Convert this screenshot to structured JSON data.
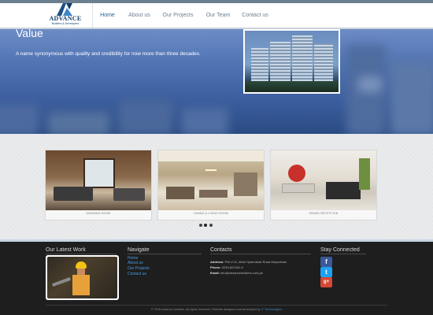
{
  "header": {
    "logo": {
      "word": "ADVANCE",
      "tagline": "Builders & Developers"
    },
    "nav": [
      {
        "label": "Home",
        "active": true
      },
      {
        "label": "About us",
        "active": false
      },
      {
        "label": "Our Projects",
        "active": false
      },
      {
        "label": "Our Team",
        "active": false
      },
      {
        "label": "Contact us",
        "active": false
      }
    ]
  },
  "hero": {
    "title": "Value",
    "text": "A name synonymous with quality and credibility for now more than three decades."
  },
  "gallery": {
    "cards": [
      {
        "caption": "DRAWING ROOM"
      },
      {
        "caption": "DINING & LIVING ROOM"
      },
      {
        "caption": "GRAND RECEPTION"
      }
    ],
    "dots": 3,
    "active_dot": 2
  },
  "footer": {
    "latest_work": {
      "heading": "Our Latest Work"
    },
    "navigate": {
      "heading": "Navigate",
      "links": [
        "Home",
        "About us",
        "Our Projects",
        "Contact us"
      ]
    },
    "contacts": {
      "heading": "Contacts",
      "address_label": "Address:",
      "address_value": "Plot # 11, Main Hyderabad Road Mirpurkhas",
      "phone_label": "Phone:",
      "phone_value": "0233-821341-0",
      "email_label": "Email:",
      "email_value": "info@advancebuilders.com.pk"
    },
    "social": {
      "heading": "Stay Connected",
      "icons": [
        "facebook-icon",
        "twitter-icon",
        "google-plus-icon"
      ]
    },
    "copyright": {
      "text": "© 2016 advance builders. All rights reserved | Website designed and developed by",
      "brand": "IT Technologies"
    }
  },
  "colors": {
    "accent": "#1f5e96",
    "link": "#4a9adf",
    "footer_bg": "#1e1e1e"
  }
}
